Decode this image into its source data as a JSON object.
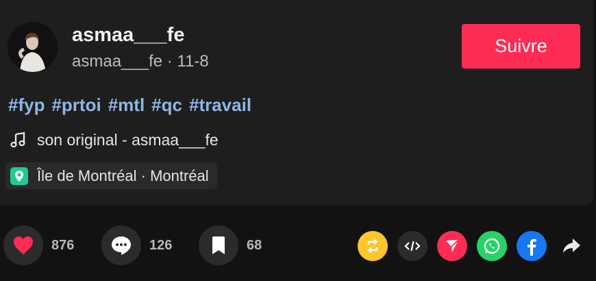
{
  "author": {
    "username": "asmaa___fe",
    "handle": "asmaa___fe",
    "separator": " · ",
    "date": "11-8",
    "follow_label": "Suivre"
  },
  "hashtags": [
    "#fyp",
    "#prtoi",
    "#mtl",
    "#qc",
    "#travail"
  ],
  "music": {
    "label": "son original - asmaa___fe"
  },
  "location": {
    "label": "Île de Montréal · Montréal"
  },
  "stats": {
    "likes": "876",
    "comments": "126",
    "saves": "68"
  },
  "share_icons": [
    "repost-icon",
    "embed-icon",
    "send-icon",
    "whatsapp-icon",
    "facebook-icon",
    "share-arrow-icon"
  ],
  "colors": {
    "accent": "#fe2c55",
    "hashtag": "#8fb6e5",
    "repost": "#fcc62d",
    "whatsapp": "#25d366",
    "facebook": "#1877f2",
    "send": "#fe2c55"
  }
}
